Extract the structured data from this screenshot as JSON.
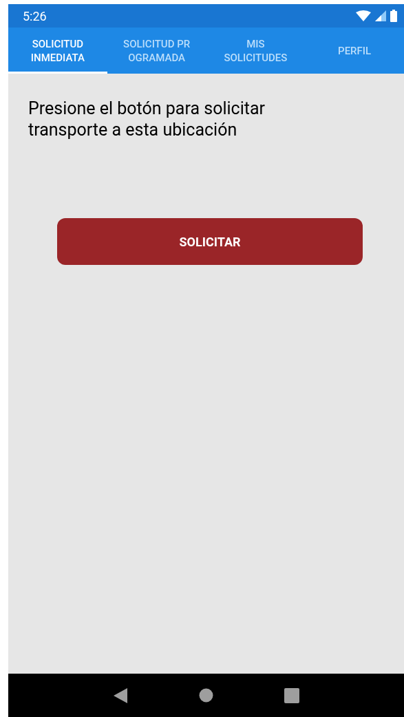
{
  "status_bar": {
    "time": "5:26"
  },
  "tabs": [
    {
      "lines": [
        "SOLICITUD",
        "INMEDIATA"
      ],
      "selected": true
    },
    {
      "lines": [
        "SOLICITUD PR",
        "OGRAMADA"
      ],
      "selected": false
    },
    {
      "lines": [
        "MIS",
        "SOLICITUDES"
      ],
      "selected": false
    },
    {
      "lines": [
        "PERFIL"
      ],
      "selected": false
    }
  ],
  "content": {
    "message": "Presione el botón para solicitar transporte a esta ubicación",
    "button": "SOLICITAR"
  }
}
